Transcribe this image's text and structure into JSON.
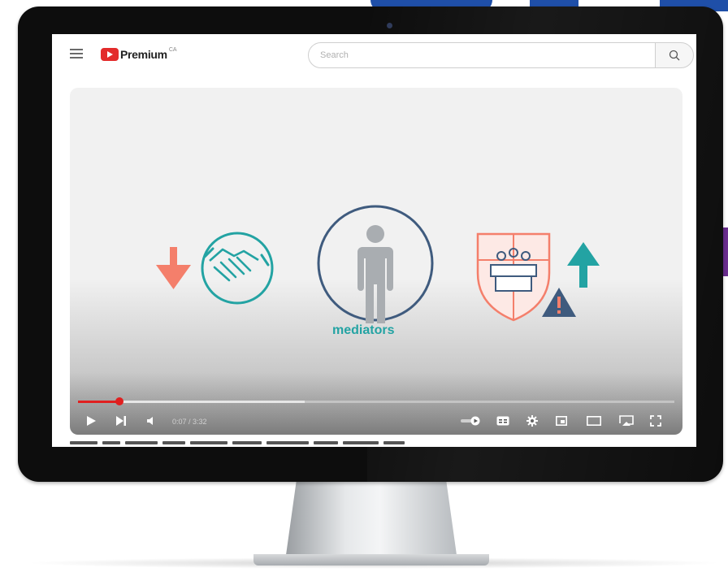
{
  "app": {
    "brand_name": "Premium",
    "brand_superscript": "CA",
    "brand_color": "#e32b2b"
  },
  "search": {
    "placeholder": "Search",
    "icon": "search-icon"
  },
  "video": {
    "caption": "mediators",
    "current_time": "0:07 / 3:32",
    "progress_fraction": 0.07,
    "buffered_fraction": 0.38,
    "accent_teal": "#23a3a3",
    "accent_salmon": "#f47f6b",
    "accent_navy": "#3f5b7e",
    "progress_color": "#e01f1f"
  },
  "controls": {
    "left": [
      "play-icon",
      "next-icon",
      "volume-icon"
    ],
    "right": [
      "autoplay-toggle-icon",
      "subtitles-icon",
      "settings-icon",
      "miniplayer-icon",
      "theater-icon",
      "cast-icon",
      "fullscreen-icon"
    ]
  }
}
